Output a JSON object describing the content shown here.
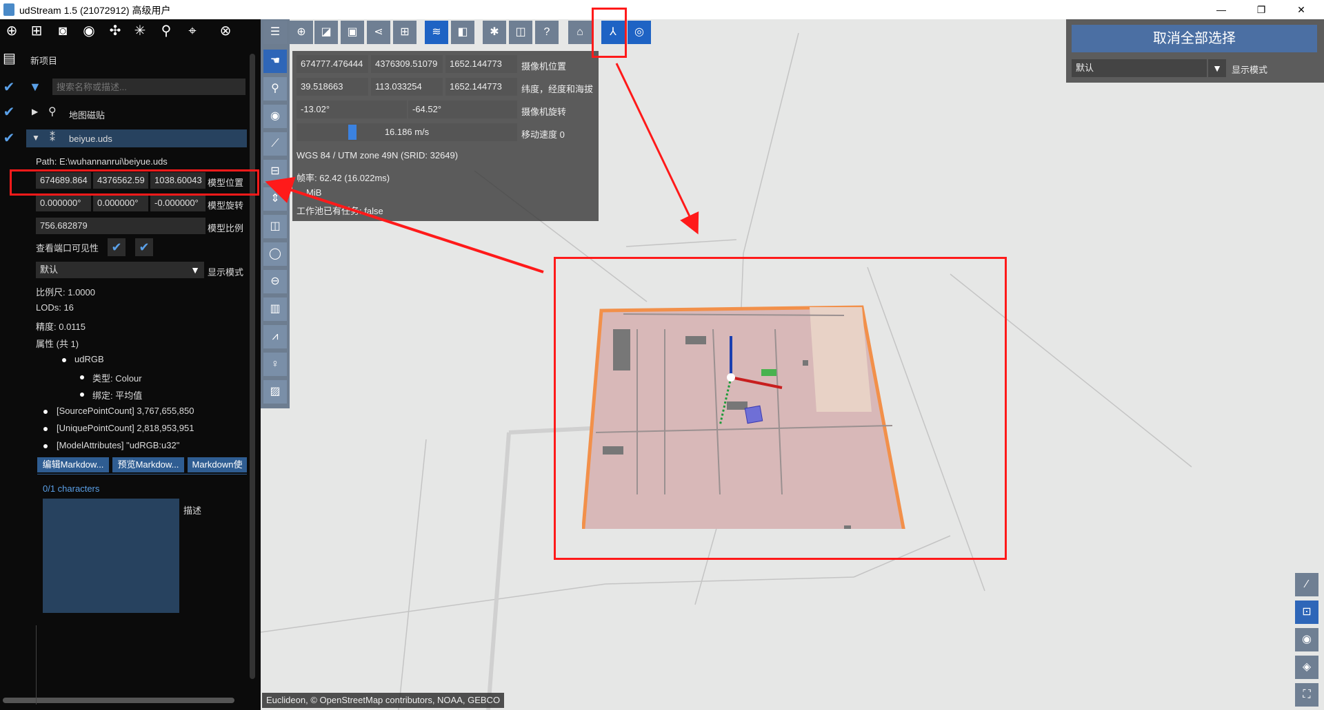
{
  "window": {
    "title": "udStream 1.5 (21072912) 高级用户",
    "minimize": "—",
    "maximize": "❐",
    "close": "✕"
  },
  "left_toolbar": {
    "icons": [
      "add-icon",
      "add-tile-icon",
      "camera-icon",
      "screenshot-icon",
      "marker-icon",
      "network-icon",
      "map-pin-icon",
      "location-pin-icon",
      "close-circle-icon"
    ]
  },
  "project": {
    "name": "新项目",
    "search_placeholder": "搜索名称或描述..."
  },
  "tree": {
    "items": [
      {
        "label": "地图磁贴",
        "expanded": false
      },
      {
        "label": "beiyue.uds",
        "expanded": true
      }
    ]
  },
  "model": {
    "path": "Path: E:\\wuhannanrui\\beiyue.uds",
    "position": [
      "674689.864",
      "4376562.59",
      "1038.60043"
    ],
    "position_label": "模型位置",
    "rotation": [
      "0.000000°",
      "0.000000°",
      "-0.000000°"
    ],
    "rotation_label": "模型旋转",
    "scale": "756.682879",
    "scale_label": "模型比例",
    "viewport_label": "查看端口可见性",
    "display_value": "默认",
    "display_label": "显示模式",
    "scale_info": "比例尺: 1.0000",
    "lods": "LODs: 16",
    "precision": "精度: 0.0115",
    "attributes": "属性 (共 1)",
    "udrgb": "udRGB",
    "type": "类型: Colour",
    "binding": "绑定: 平均值",
    "source_count": "[SourcePointCount] 3,767,655,850",
    "unique_count": "[UniquePointCount] 2,818,953,951",
    "model_attrs": "[ModelAttributes] \"udRGB:u32\"",
    "tabs": [
      "编辑Markdow...",
      "预览Markdow...",
      "Markdown使"
    ],
    "char_count": "0/1 characters",
    "desc_label": "描述"
  },
  "camera": {
    "position": [
      "674777.476444",
      "4376309.51079",
      "1652.144773"
    ],
    "position_label": "摄像机位置",
    "latlon": [
      "39.518663",
      "113.033254",
      "1652.144773"
    ],
    "latlon_label": "纬度，经度和海拔",
    "rotation": [
      "-13.02°",
      "-64.52°"
    ],
    "rotation_label": "摄像机旋转",
    "speed": "16.186 m/s",
    "speed_label": "移动速度 0",
    "speed_fraction": 0.06,
    "srid": "WGS 84 / UTM zone 49N (SRID: 32649)",
    "fps": "帧率: 62.42 (16.022ms)",
    "mem": "MiB",
    "workers": "工作池已有任务: false"
  },
  "right_panel": {
    "deselect_all": "取消全部选择",
    "display_value": "默认",
    "display_label": "显示模式"
  },
  "attribution": "Euclideon, © OpenStreetMap contributors, NOAA, GEBCO",
  "colors": {
    "accent": "#2e66b8",
    "annotation": "#ff1a1a"
  }
}
